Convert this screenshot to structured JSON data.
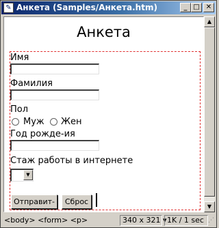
{
  "window": {
    "title": "Анкета (Samples/Анкета.htm)",
    "controls": {
      "minimize": "_",
      "maximize": "□",
      "close": "✕"
    }
  },
  "page": {
    "heading": "Анкета",
    "form": {
      "fields": [
        {
          "label": "Имя",
          "value": ""
        },
        {
          "label": "Фамилия",
          "value": ""
        },
        {
          "label": "Год рожде-ия",
          "value": ""
        }
      ],
      "gender": {
        "label": "Пол",
        "options": [
          "Муж",
          "Жен"
        ]
      },
      "experience": {
        "label": "Стаж работы в интернете",
        "selected": ""
      },
      "buttons": {
        "submit": "Отправит-",
        "reset": "Сброс"
      }
    }
  },
  "statusbar": {
    "tag_path": "<body> <form> <p>",
    "window_size": "340 x 321",
    "download": "1K / 1 sec"
  },
  "icons": {
    "app": "document-icon",
    "scroll_up": "scroll-up-arrow-icon",
    "scroll_down": "scroll-down-arrow-icon",
    "dropdown": "dropdown-arrow-icon"
  }
}
